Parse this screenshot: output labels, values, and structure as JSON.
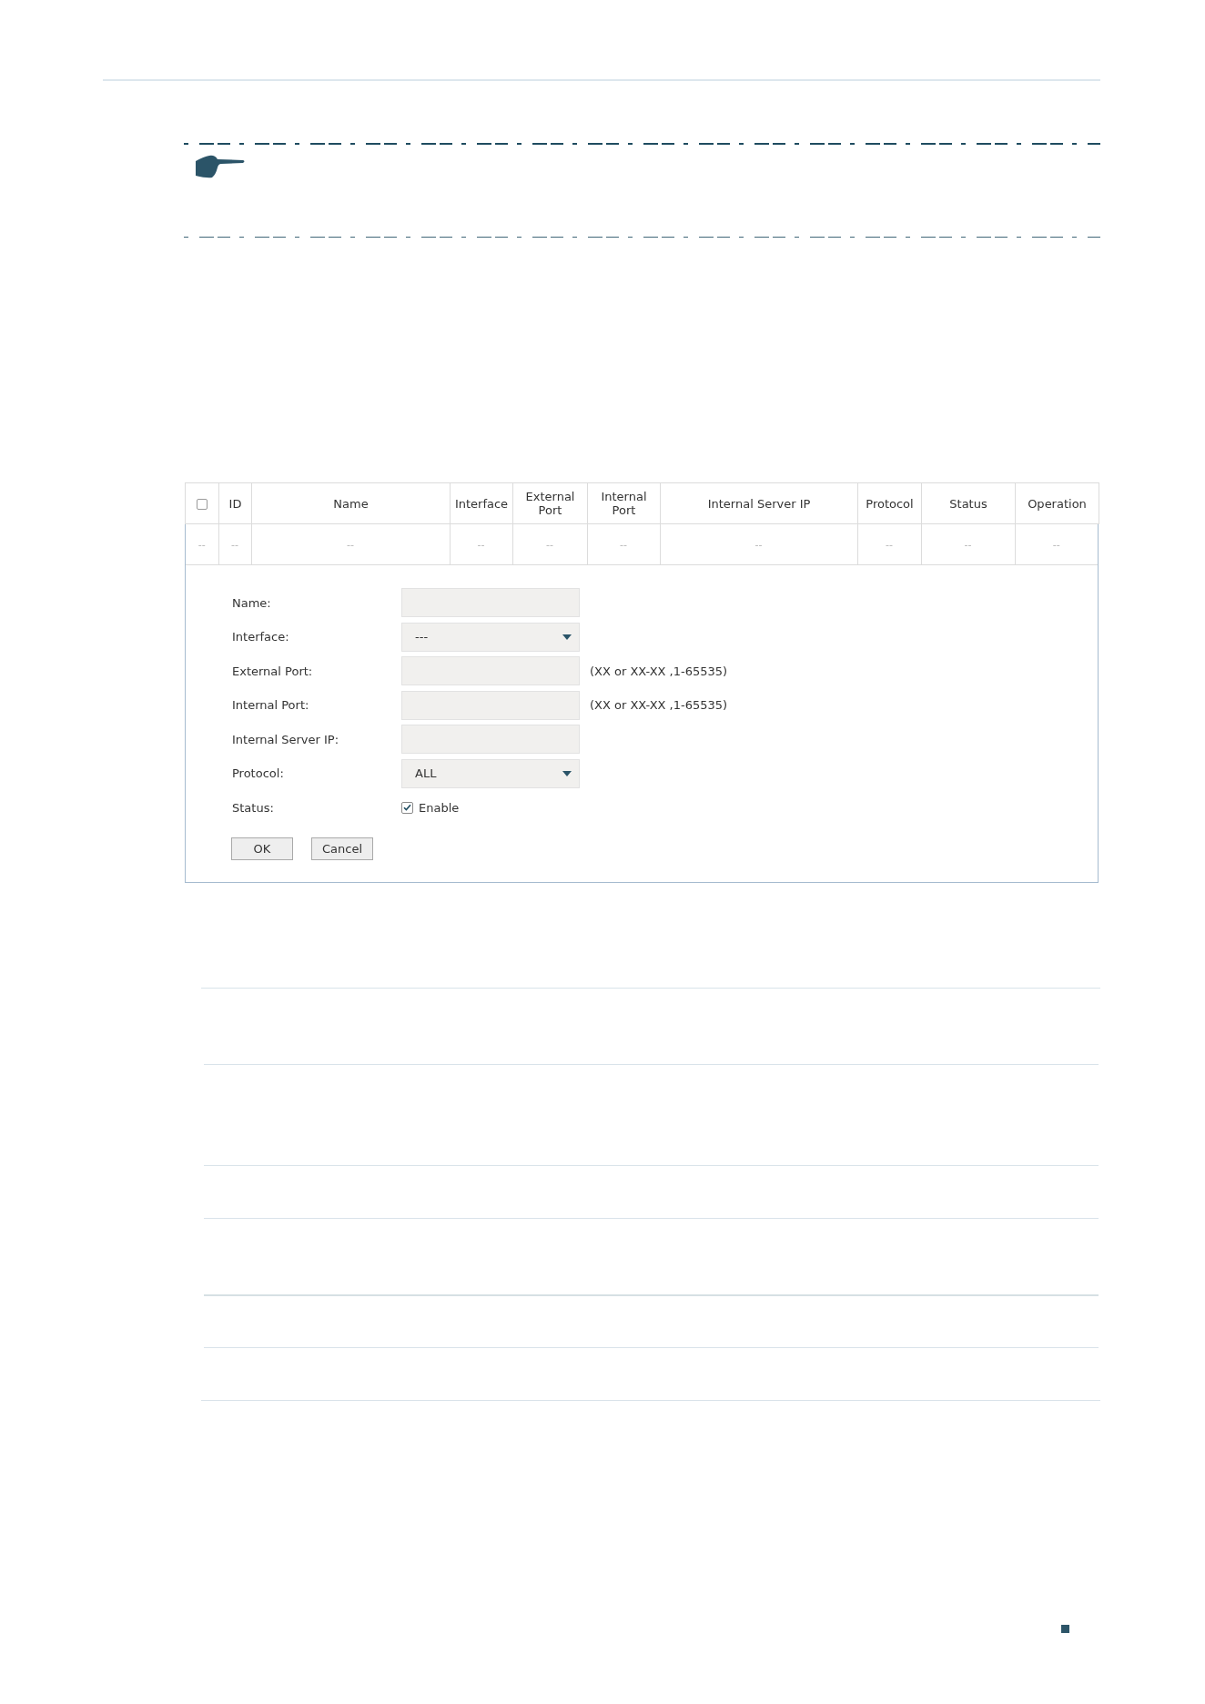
{
  "table": {
    "columns": [
      {
        "kind": "select_all",
        "checked": false
      },
      {
        "kind": "label",
        "label": "ID"
      },
      {
        "kind": "label",
        "label": "Name"
      },
      {
        "kind": "label",
        "label": "Interface"
      },
      {
        "kind": "label",
        "label": "External Port"
      },
      {
        "kind": "label",
        "label": "Internal Port"
      },
      {
        "kind": "label",
        "label": "Internal Server IP"
      },
      {
        "kind": "label",
        "label": "Protocol"
      },
      {
        "kind": "label",
        "label": "Status"
      },
      {
        "kind": "label",
        "label": "Operation"
      }
    ],
    "rows": [
      {
        "cells": [
          "--",
          "--",
          "--",
          "--",
          "--",
          "--",
          "--",
          "--",
          "--",
          "--"
        ]
      }
    ]
  },
  "form": {
    "fields": [
      {
        "kind": "text",
        "label": "Name:"
      },
      {
        "kind": "select",
        "label": "Interface:",
        "value": "---"
      },
      {
        "kind": "text",
        "label": "External Port:",
        "hint": "(XX or XX-XX ,1-65535)"
      },
      {
        "kind": "text",
        "label": "Internal Port:",
        "hint": "(XX or XX-XX ,1-65535)"
      },
      {
        "kind": "text",
        "label": "Internal Server IP:"
      },
      {
        "kind": "select",
        "label": "Protocol:",
        "value": "ALL"
      },
      {
        "kind": "checkbox",
        "label": "Status:",
        "option": "Enable",
        "checked": true
      }
    ],
    "buttons": [
      "OK",
      "Cancel"
    ]
  }
}
